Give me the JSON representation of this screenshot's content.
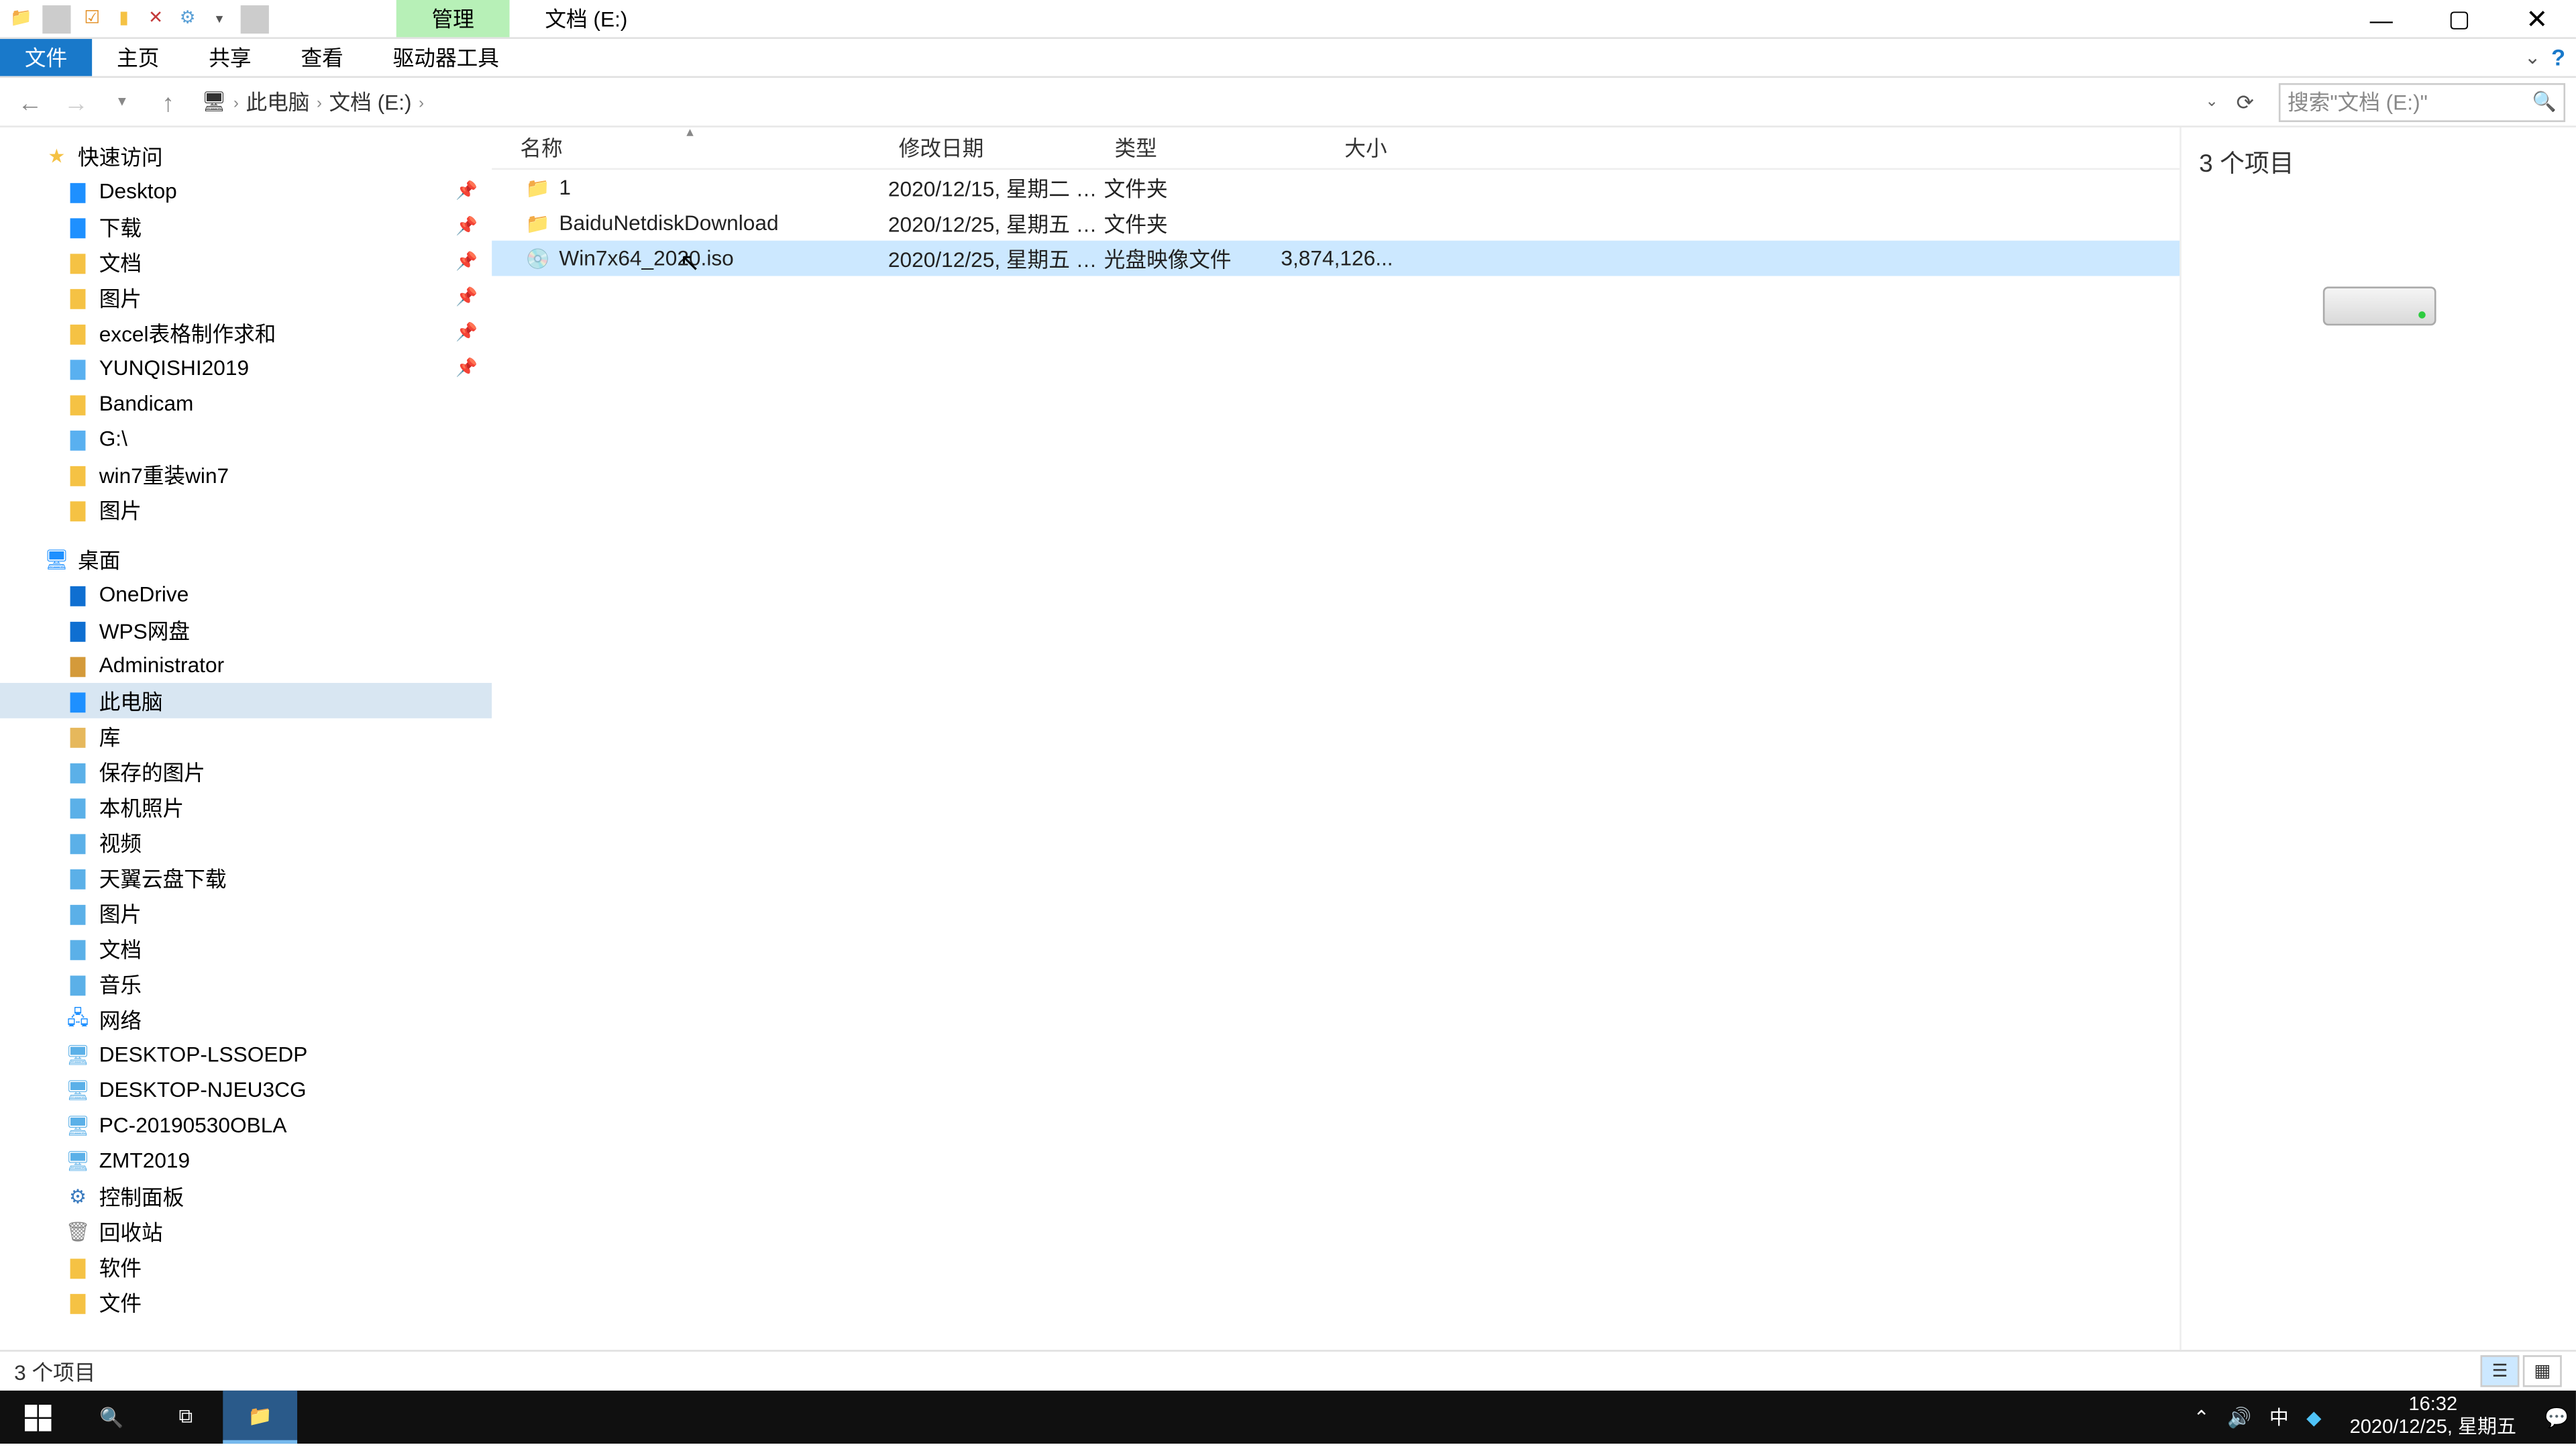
{
  "title_context_tab": "管理",
  "title_path": "文档 (E:)",
  "ribbon": {
    "file": "文件",
    "tabs": [
      "主页",
      "共享",
      "查看",
      "驱动器工具"
    ]
  },
  "nav": {
    "breadcrumb": [
      "此电脑",
      "文档 (E:)"
    ],
    "search_placeholder": "搜索\"文档 (E:)\""
  },
  "sidebar": {
    "quick_access": "快速访问",
    "quick_items": [
      {
        "label": "Desktop",
        "pinned": true,
        "color": "#1e90ff"
      },
      {
        "label": "下载",
        "pinned": true,
        "color": "#1e90ff"
      },
      {
        "label": "文档",
        "pinned": true,
        "color": "#f5c244"
      },
      {
        "label": "图片",
        "pinned": true,
        "color": "#f5c244"
      },
      {
        "label": "excel表格制作求和",
        "pinned": true,
        "color": "#f5c244"
      },
      {
        "label": "YUNQISHI2019",
        "pinned": true,
        "color": "#59b0f0"
      },
      {
        "label": "Bandicam",
        "pinned": false,
        "color": "#f5c244"
      },
      {
        "label": "G:\\",
        "pinned": false,
        "color": "#59b0f0"
      },
      {
        "label": "win7重装win7",
        "pinned": false,
        "color": "#f5c244"
      },
      {
        "label": "图片",
        "pinned": false,
        "color": "#f5c244"
      }
    ],
    "desktop": "桌面",
    "desktop_items": [
      {
        "label": "OneDrive",
        "color": "#0f6fd1"
      },
      {
        "label": "WPS网盘",
        "color": "#0f6fd1"
      },
      {
        "label": "Administrator",
        "color": "#d49a3a"
      },
      {
        "label": "此电脑",
        "color": "#1e90ff",
        "selected": true
      },
      {
        "label": "库",
        "color": "#e6b85c"
      }
    ],
    "lib_items": [
      {
        "label": "保存的图片",
        "color": "#5bb0e8"
      },
      {
        "label": "本机照片",
        "color": "#5bb0e8"
      },
      {
        "label": "视频",
        "color": "#5bb0e8"
      },
      {
        "label": "天翼云盘下载",
        "color": "#5bb0e8"
      },
      {
        "label": "图片",
        "color": "#5bb0e8"
      },
      {
        "label": "文档",
        "color": "#5bb0e8"
      },
      {
        "label": "音乐",
        "color": "#5bb0e8"
      }
    ],
    "network": "网络",
    "network_items": [
      {
        "label": "DESKTOP-LSSOEDP"
      },
      {
        "label": "DESKTOP-NJEU3CG"
      },
      {
        "label": "PC-20190530OBLA"
      },
      {
        "label": "ZMT2019"
      }
    ],
    "control_panel": "控制面板",
    "recycle": "回收站",
    "software": "软件",
    "documents": "文件"
  },
  "columns": {
    "name": "名称",
    "date": "修改日期",
    "type": "类型",
    "size": "大小"
  },
  "files": [
    {
      "icon": "folder",
      "name": "1",
      "date": "2020/12/15, 星期二 1...",
      "type": "文件夹",
      "size": ""
    },
    {
      "icon": "folder",
      "name": "BaiduNetdiskDownload",
      "date": "2020/12/25, 星期五 1...",
      "type": "文件夹",
      "size": ""
    },
    {
      "icon": "iso",
      "name": "Win7x64_2020.iso",
      "date": "2020/12/25, 星期五 1...",
      "type": "光盘映像文件",
      "size": "3,874,126...",
      "selected": true
    }
  ],
  "preview": {
    "count_label": "3 个项目"
  },
  "status": {
    "left": "3 个项目"
  },
  "taskbar": {
    "time": "16:32",
    "date": "2020/12/25, 星期五",
    "ime": "中"
  }
}
